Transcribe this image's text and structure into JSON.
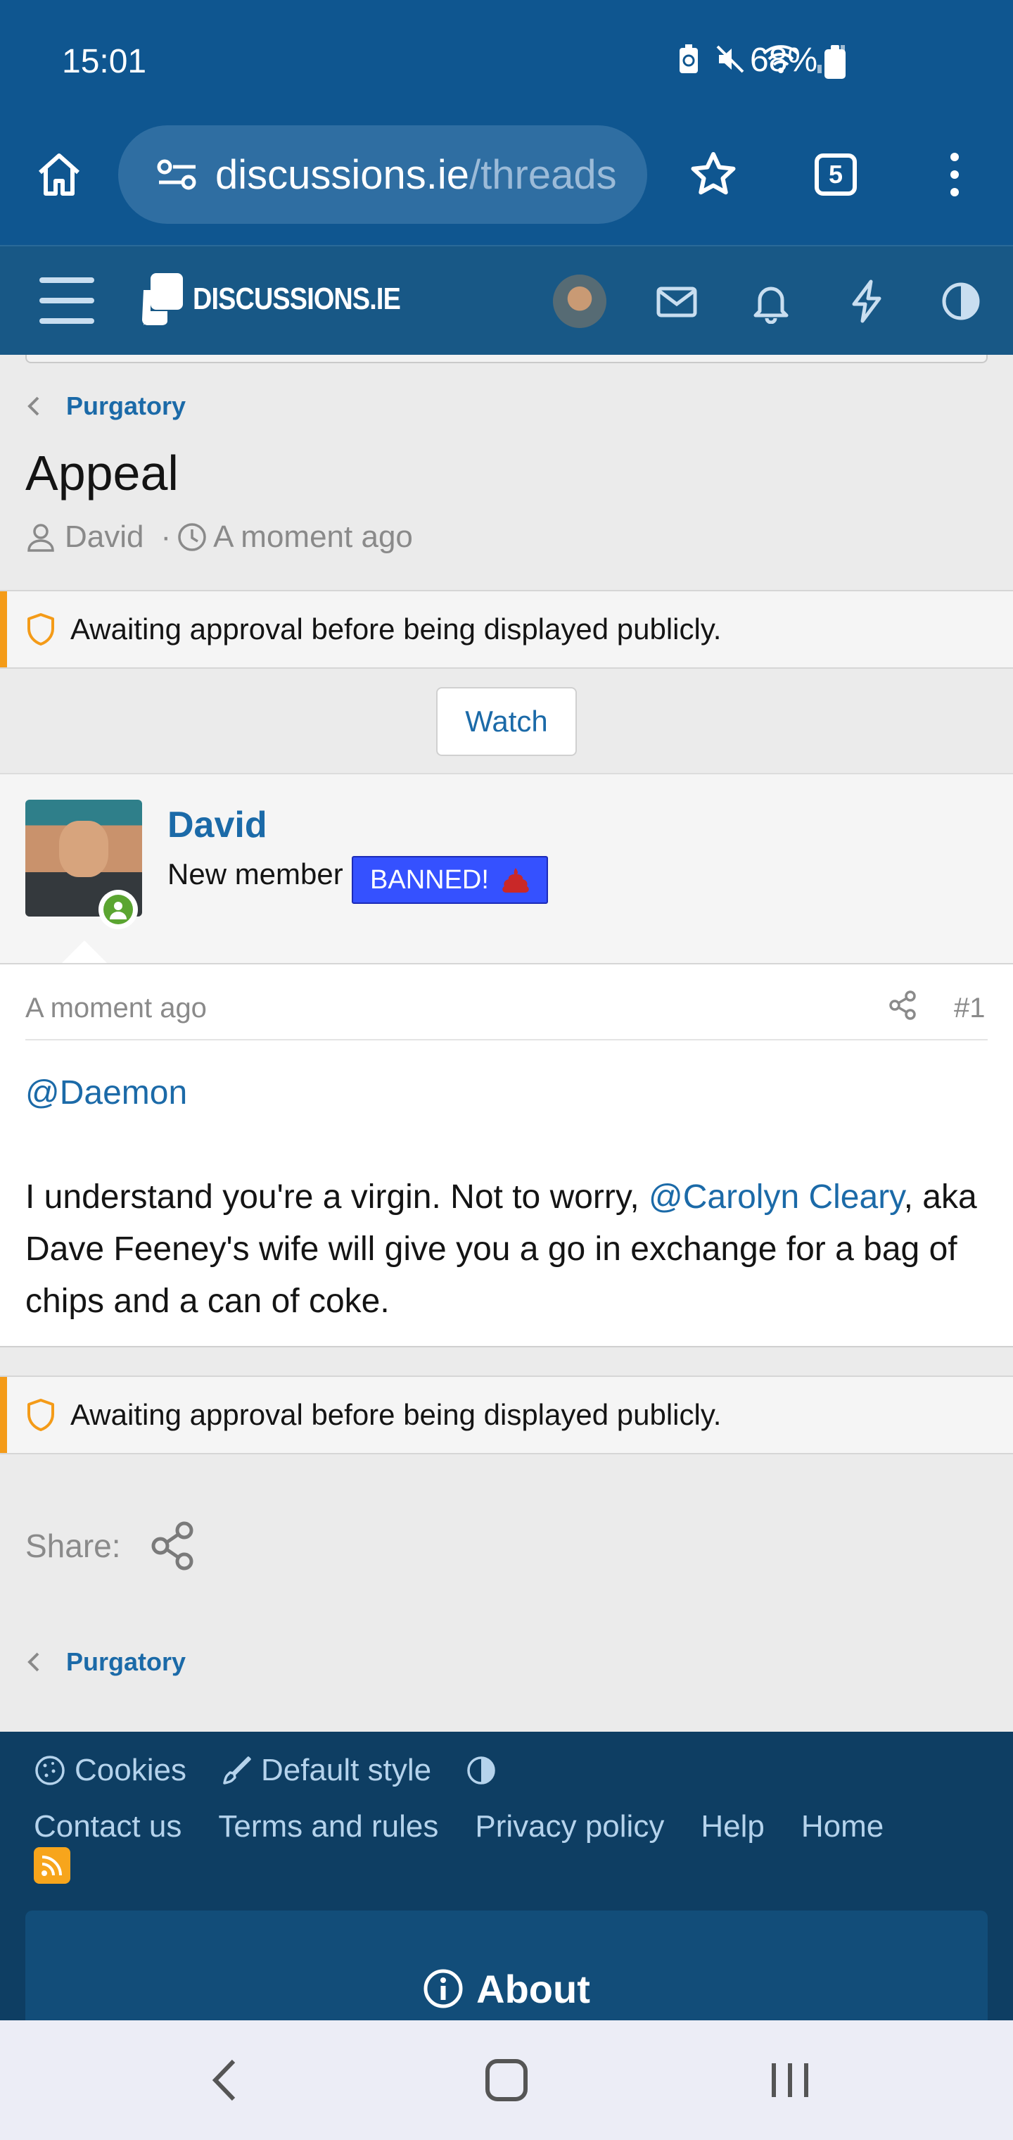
{
  "status_bar": {
    "time": "15:01",
    "battery": "68%",
    "icons": [
      "battery-saver-icon",
      "mute-icon",
      "wifi-icon",
      "signal-icon"
    ]
  },
  "browser": {
    "url_host": "discussions.ie",
    "url_path": "/threads",
    "tab_count": "5",
    "icons": [
      "home-icon",
      "site-settings-icon",
      "bookmark-star-icon",
      "more-icon"
    ]
  },
  "site_header": {
    "logo_text": "DISCUSSIONS.IE",
    "icons": [
      "menu-icon",
      "mail-icon",
      "bell-icon",
      "bolt-icon",
      "theme-toggle-icon"
    ]
  },
  "thread": {
    "breadcrumb": "Purgatory",
    "title": "Appeal",
    "author": "David",
    "meta_separator": "·",
    "time": "A moment ago",
    "notice": "Awaiting approval before being displayed publicly.",
    "watch_label": "Watch"
  },
  "post": {
    "username": "David",
    "user_title": "New member",
    "banner_text": "BANNED!",
    "date": "A moment ago",
    "number": "#1",
    "mention_1": "@Daemon",
    "body_text_1": "I understand you're a virgin. Not to worry, ",
    "mention_2": "@Carolyn Cleary",
    "body_text_2": ", aka Dave Feeney's wife will give you a go in exchange for a bag of chips and a can of coke."
  },
  "share": {
    "label": "Share:"
  },
  "footer": {
    "cookies": "Cookies",
    "style": "Default style",
    "links": [
      "Contact us",
      "Terms and rules",
      "Privacy policy",
      "Help",
      "Home"
    ],
    "about": "About"
  },
  "colors": {
    "chrome_blue": "#0f5690",
    "header_blue": "#185886",
    "link_blue": "#1b6aa8",
    "notice_orange": "#f49b18",
    "banned_blue": "#3551ff",
    "online_green": "#5ba531",
    "footer_navy": "#0e3e63"
  }
}
